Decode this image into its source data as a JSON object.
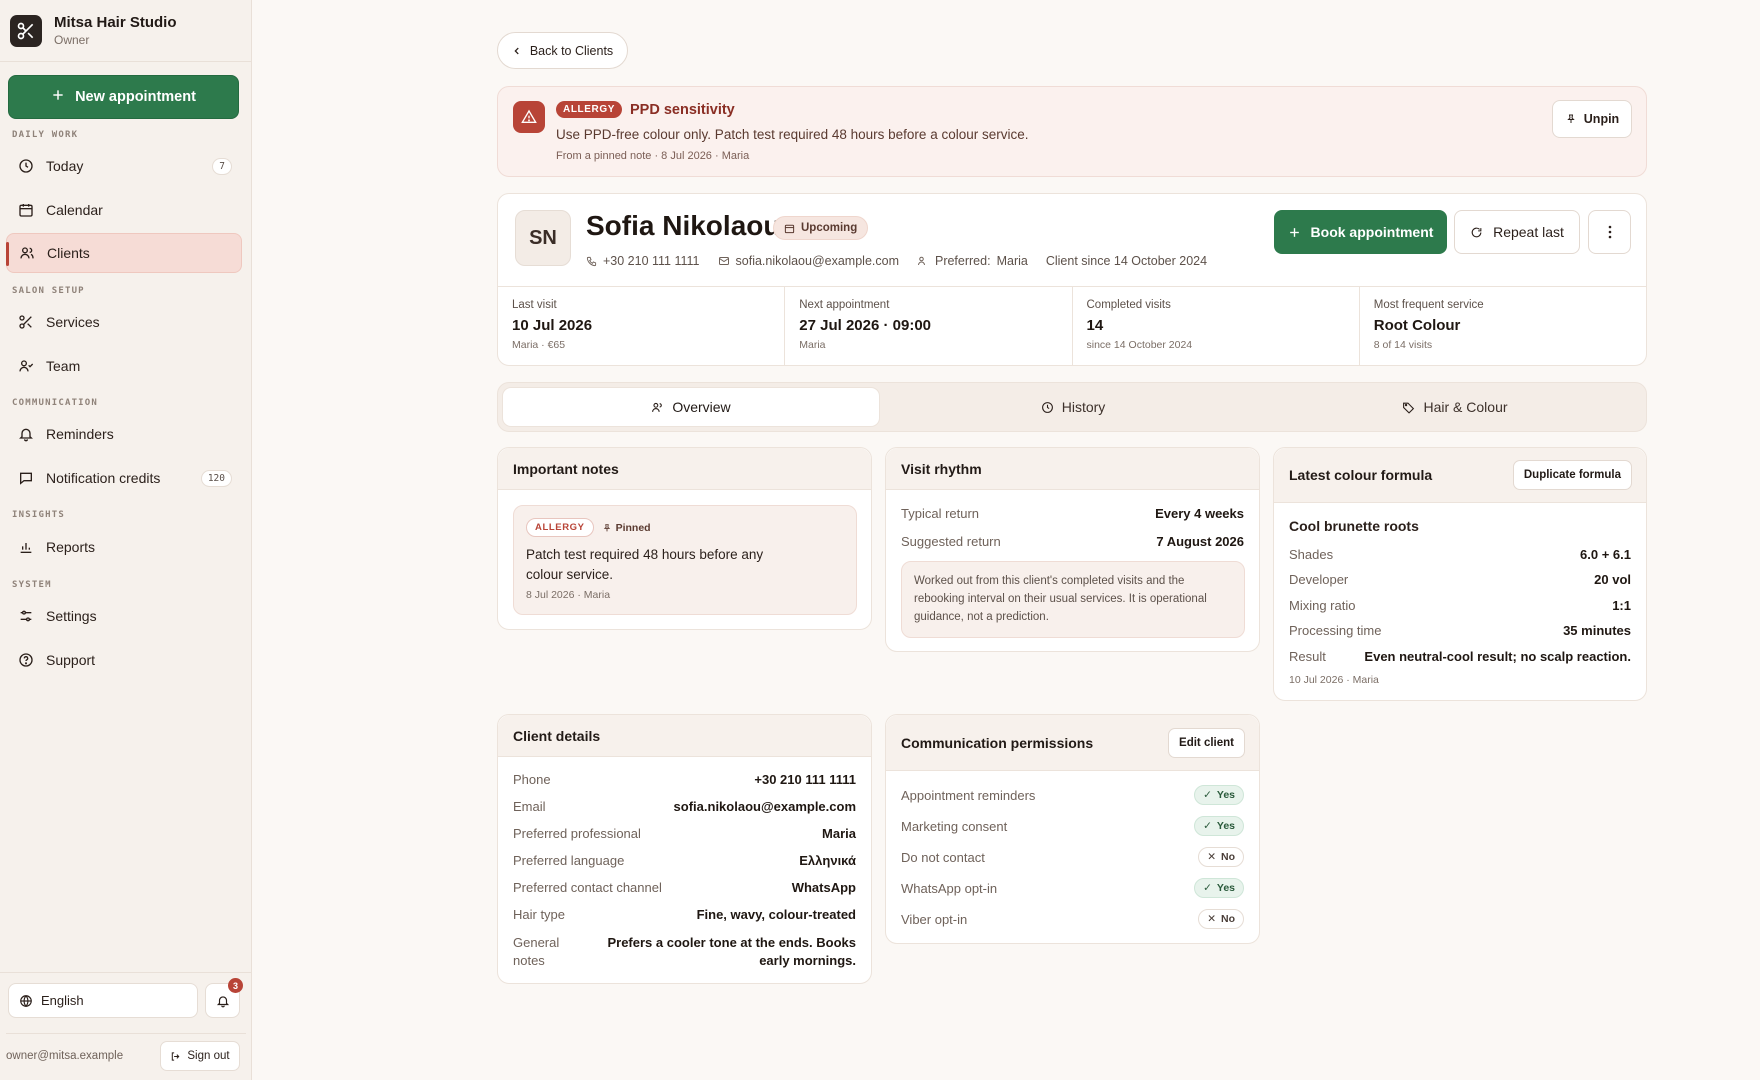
{
  "brand": {
    "name": "Mitsa Hair Studio",
    "role": "Owner"
  },
  "sidebar": {
    "new_appointment": "New appointment",
    "sections": {
      "daily_work": "DAILY WORK",
      "salon_setup": "SALON SETUP",
      "communication": "COMMUNICATION",
      "insights": "INSIGHTS",
      "system": "SYSTEM"
    },
    "items": {
      "today": {
        "label": "Today",
        "count": "7"
      },
      "calendar": {
        "label": "Calendar"
      },
      "clients": {
        "label": "Clients"
      },
      "services": {
        "label": "Services"
      },
      "team": {
        "label": "Team"
      },
      "reminders": {
        "label": "Reminders"
      },
      "credits": {
        "label": "Notification credits",
        "count": "120"
      },
      "reports": {
        "label": "Reports"
      },
      "settings": {
        "label": "Settings"
      },
      "support": {
        "label": "Support"
      }
    },
    "language": "English",
    "notifications_count": "3",
    "owner_email": "owner@mitsa.example",
    "sign_out": "Sign out"
  },
  "header": {
    "back_label": "Back to Clients"
  },
  "allergy_banner": {
    "badge": "ALLERGY",
    "title": "PPD sensitivity",
    "text": "Use PPD-free colour only. Patch test required 48 hours before a colour service.",
    "meta": "From a pinned note · 8 Jul 2026 · Maria",
    "unpin": "Unpin"
  },
  "client": {
    "initials": "SN",
    "name": "Sofia Nikolaou",
    "status": "Upcoming",
    "phone": "+30 210 111 1111",
    "email": "sofia.nikolaou@example.com",
    "preferred_label": "Preferred:",
    "preferred": "Maria",
    "since": "Client since 14 October 2024",
    "book": "Book appointment",
    "repeat": "Repeat last"
  },
  "stats": [
    {
      "label": "Last visit",
      "value": "10 Jul 2026",
      "sub": "Maria · €65"
    },
    {
      "label": "Next appointment",
      "value": "27 Jul 2026 · 09:00",
      "sub": "Maria"
    },
    {
      "label": "Completed visits",
      "value": "14",
      "sub": "since 14 October 2024"
    },
    {
      "label": "Most frequent service",
      "value": "Root Colour",
      "sub": "8 of 14 visits"
    }
  ],
  "tabs": [
    "Overview",
    "History",
    "Hair & Colour"
  ],
  "important_notes": {
    "title": "Important notes",
    "badge": "ALLERGY",
    "pinned": "Pinned",
    "text": "Patch test required 48 hours before any colour service.",
    "meta": "8 Jul 2026 · Maria"
  },
  "visit_rhythm": {
    "title": "Visit rhythm",
    "typical_label": "Typical return",
    "typical": "Every 4 weeks",
    "suggested_label": "Suggested return",
    "suggested": "7 August 2026",
    "note": "Worked out from this client's completed visits and the rebooking interval on their usual services. It is operational guidance, not a prediction."
  },
  "colour_formula": {
    "title": "Latest colour formula",
    "duplicate": "Duplicate formula",
    "name": "Cool brunette roots",
    "rows": [
      {
        "k": "Shades",
        "v": "6.0 + 6.1"
      },
      {
        "k": "Developer",
        "v": "20 vol"
      },
      {
        "k": "Mixing ratio",
        "v": "1:1"
      },
      {
        "k": "Processing time",
        "v": "35 minutes"
      },
      {
        "k": "Result",
        "v": "Even neutral-cool result; no scalp reaction."
      }
    ],
    "meta": "10 Jul 2026 · Maria"
  },
  "client_details": {
    "title": "Client details",
    "rows": [
      {
        "k": "Phone",
        "v": "+30 210 111 1111"
      },
      {
        "k": "Email",
        "v": "sofia.nikolaou@example.com"
      },
      {
        "k": "Preferred professional",
        "v": "Maria"
      },
      {
        "k": "Preferred language",
        "v": "Ελληνικά"
      },
      {
        "k": "Preferred contact channel",
        "v": "WhatsApp"
      },
      {
        "k": "Hair type",
        "v": "Fine, wavy, colour-treated"
      }
    ],
    "general_label": "General notes",
    "general": "Prefers a cooler tone at the ends. Books early mornings."
  },
  "permissions": {
    "title": "Communication permissions",
    "edit": "Edit client",
    "rows": [
      {
        "k": "Appointment reminders",
        "v": "Yes"
      },
      {
        "k": "Marketing consent",
        "v": "Yes"
      },
      {
        "k": "Do not contact",
        "v": "No"
      },
      {
        "k": "WhatsApp opt-in",
        "v": "Yes"
      },
      {
        "k": "Viber opt-in",
        "v": "No"
      }
    ]
  },
  "colors": {
    "accent_green": "#2d7a4c",
    "allergy_red": "#b84437",
    "active_nav": "#f6dcd6"
  }
}
